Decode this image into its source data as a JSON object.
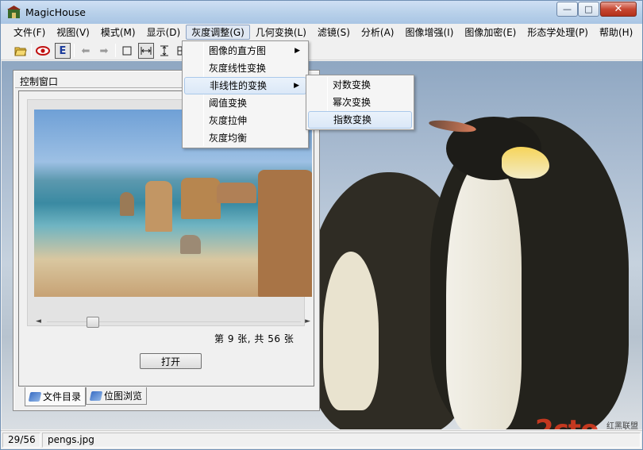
{
  "window": {
    "title": "MagicHouse",
    "minimize_glyph": "—",
    "maximize_glyph": "□",
    "close_glyph": "✕"
  },
  "menubar": [
    {
      "label": "文件(F)"
    },
    {
      "label": "视图(V)"
    },
    {
      "label": "模式(M)"
    },
    {
      "label": "显示(D)"
    },
    {
      "label": "灰度调整(G)"
    },
    {
      "label": "几何变换(L)"
    },
    {
      "label": "滤镜(S)"
    },
    {
      "label": "分析(A)"
    },
    {
      "label": "图像增强(I)"
    },
    {
      "label": "图像加密(E)"
    },
    {
      "label": "形态学处理(P)"
    },
    {
      "label": "帮助(H)"
    }
  ],
  "toolbar": {
    "open_icon": "open-folder-icon",
    "eye_icon": "eye-icon",
    "e_button": "E",
    "back_icon": "arrow-left-icon",
    "forward_icon": "arrow-right-icon",
    "select_icon": "rectangle-select-icon",
    "fit_width_icon": "fit-width-icon",
    "fit_height_icon": "fit-height-icon"
  },
  "gray_menu": {
    "items": [
      {
        "label": "图像的直方图",
        "has_submenu": true
      },
      {
        "label": "灰度线性变换",
        "has_submenu": false
      },
      {
        "label": "非线性的变换",
        "has_submenu": true,
        "highlighted": true
      },
      {
        "label": "阈值变换",
        "has_submenu": false
      },
      {
        "label": "灰度拉伸",
        "has_submenu": false
      },
      {
        "label": "灰度均衡",
        "has_submenu": false
      }
    ]
  },
  "nonlinear_submenu": {
    "items": [
      {
        "label": "对数变换"
      },
      {
        "label": "幂次变换"
      },
      {
        "label": "指数变换",
        "highlighted": true
      }
    ]
  },
  "control_window": {
    "title": "控制窗口",
    "counter": "第 9 张, 共 56 张",
    "open_button": "打开",
    "tabs": [
      {
        "label": "文件目录",
        "selected": true
      },
      {
        "label": "位图浏览",
        "selected": false
      }
    ]
  },
  "watermark": {
    "main": "2cto",
    "sub": "红黑联盟"
  },
  "statusbar": {
    "position": "29/56",
    "filename": "pengs.jpg"
  }
}
